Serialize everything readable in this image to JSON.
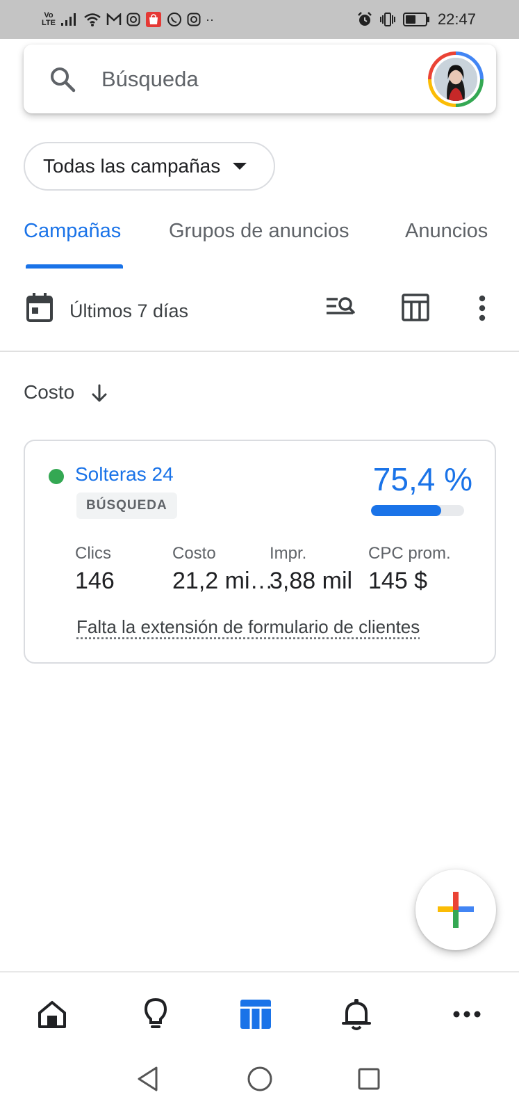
{
  "status_bar": {
    "volte_top": "Vo",
    "volte_bottom": "LTE",
    "time": "22:47",
    "more": "··",
    "icons": [
      "signal-icon",
      "wifi-icon",
      "gmail-icon",
      "instagram-icon",
      "shopping-icon",
      "whatsapp-icon",
      "instagram-icon",
      "alarm-icon",
      "vibrate-icon",
      "battery-icon"
    ]
  },
  "search": {
    "placeholder": "Búsqueda"
  },
  "filter": {
    "label": "Todas las campañas"
  },
  "tabs": [
    {
      "label": "Campañas",
      "active": true
    },
    {
      "label": "Grupos de anuncios",
      "active": false
    },
    {
      "label": "Anuncios",
      "active": false
    }
  ],
  "toolbar": {
    "date_range": "Últimos 7 días"
  },
  "sort": {
    "label": "Costo"
  },
  "campaign": {
    "name": "Solteras 24",
    "type": "BÚSQUEDA",
    "status_color": "#34a853",
    "percent_text": "75,4 %",
    "percent_value": 0.754,
    "metrics": [
      {
        "label": "Clics",
        "value": "146"
      },
      {
        "label": "Costo",
        "value": "21,2 mi…"
      },
      {
        "label": "Impr.",
        "value": "3,88 mil"
      },
      {
        "label": "CPC prom.",
        "value": "145 $"
      }
    ],
    "warning": "Falta la extensión de formulario de clientes"
  },
  "bottom_nav": {
    "items": [
      "home-icon",
      "lightbulb-icon",
      "campaigns-table-icon",
      "notifications-bell-icon",
      "more-horizontal-icon"
    ],
    "active": "campaigns-table-icon"
  },
  "colors": {
    "accent": "#1a73e8",
    "status_bar": "#c4c4c4",
    "google_blue": "#4285f4",
    "google_red": "#ea4335",
    "google_yellow": "#fbbc05",
    "google_green": "#34a853"
  }
}
